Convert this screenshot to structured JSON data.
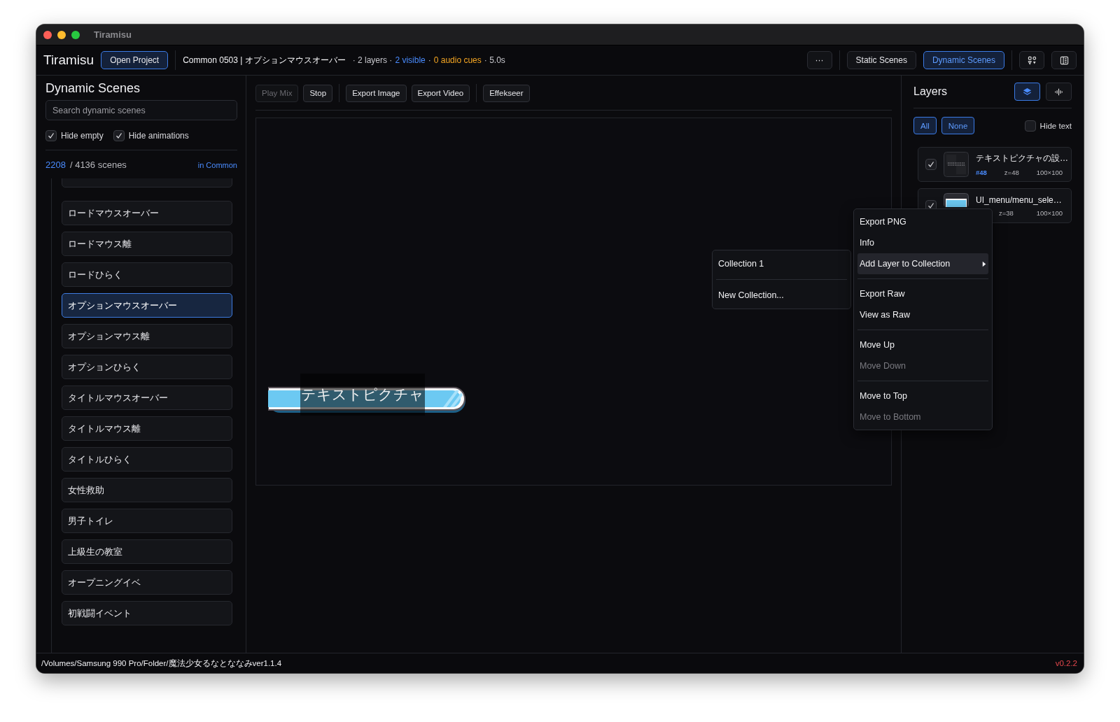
{
  "window": {
    "title": "Tiramisu"
  },
  "toolbar": {
    "app_name": "Tiramisu",
    "open_button": "Open Project",
    "scene_title": "Common 0503 | オプションマウスオーバー",
    "stats": [
      {
        "text": "· 2 layers ·",
        "kind": "plain"
      },
      {
        "text": "2 visible",
        "kind": "visible"
      },
      {
        "text": "·",
        "kind": "plain"
      },
      {
        "text": "0 audio cues",
        "kind": "audio"
      },
      {
        "text": "· 5.0s",
        "kind": "plain"
      }
    ],
    "more_button": "···",
    "mode_tabs": [
      {
        "label": "Static Scenes",
        "selected": false
      },
      {
        "label": "Dynamic Scenes",
        "selected": true
      }
    ]
  },
  "sidebar": {
    "title": "Dynamic Scenes",
    "search": {
      "placeholder": "Search dynamic scenes"
    },
    "filters": [
      {
        "label": "Hide empty",
        "checked": true
      },
      {
        "label": "Hide animations",
        "checked": true
      }
    ],
    "count": "2208",
    "total": "/ 4136 scenes",
    "scope": "in Common",
    "items": [
      {
        "label": "ロードマウスオーバー",
        "selected": false
      },
      {
        "label": "ロードマウス離",
        "selected": false
      },
      {
        "label": "ロードひらく",
        "selected": false
      },
      {
        "label": "オプションマウスオーバー",
        "selected": true
      },
      {
        "label": "オプションマウス離",
        "selected": false
      },
      {
        "label": "オプションひらく",
        "selected": false
      },
      {
        "label": "タイトルマウスオーバー",
        "selected": false
      },
      {
        "label": "タイトルマウス離",
        "selected": false
      },
      {
        "label": "タイトルひらく",
        "selected": false
      },
      {
        "label": "女性救助",
        "selected": false
      },
      {
        "label": "男子トイレ",
        "selected": false
      },
      {
        "label": "上級生の教室",
        "selected": false
      },
      {
        "label": "オープニングイベ",
        "selected": false
      },
      {
        "label": "初戦闘イベント",
        "selected": false
      }
    ]
  },
  "action_groups": [
    [
      {
        "label": "Play Mix",
        "disabled": true
      },
      {
        "label": "Stop",
        "disabled": false
      }
    ],
    [
      {
        "label": "Export Image",
        "disabled": false
      },
      {
        "label": "Export Video",
        "disabled": false
      }
    ],
    [
      {
        "label": "Effekseer",
        "disabled": false
      }
    ]
  ],
  "canvas": {
    "text_layer": "テキストピクチャ"
  },
  "layers_panel": {
    "title": "Layers",
    "view_toggles": [
      {
        "kind": "layers",
        "selected": true
      },
      {
        "kind": "audio",
        "selected": false
      }
    ],
    "filter_buttons": [
      "All",
      "None"
    ],
    "hide_text": {
      "label": "Hide text",
      "checked": false
    },
    "layers": [
      {
        "kind": "text",
        "name": "テキストピクチャの設…",
        "id": "#48",
        "z": "z=48",
        "size": "100×100",
        "checked": true
      },
      {
        "kind": "image",
        "name": "UI_menu/menu_sele…",
        "z": "z=38",
        "size": "100×100",
        "checked": true
      }
    ]
  },
  "context_menu": {
    "items": [
      {
        "kind": "item",
        "label": "Export PNG",
        "disabled": false,
        "highlighted": false,
        "submenu": false
      },
      {
        "kind": "item",
        "label": "Info",
        "disabled": false,
        "highlighted": false,
        "submenu": false
      },
      {
        "kind": "item",
        "label": "Add Layer to Collection",
        "disabled": false,
        "highlighted": true,
        "submenu": true
      },
      {
        "kind": "separator"
      },
      {
        "kind": "item",
        "label": "Export Raw",
        "disabled": false,
        "highlighted": false,
        "submenu": false
      },
      {
        "kind": "item",
        "label": "View as Raw",
        "disabled": false,
        "highlighted": false,
        "submenu": false
      },
      {
        "kind": "separator"
      },
      {
        "kind": "item",
        "label": "Move Up",
        "disabled": false,
        "highlighted": false,
        "submenu": false
      },
      {
        "kind": "item",
        "label": "Move Down",
        "disabled": true,
        "highlighted": false,
        "submenu": false
      },
      {
        "kind": "separator"
      },
      {
        "kind": "item",
        "label": "Move to Top",
        "disabled": false,
        "highlighted": false,
        "submenu": false
      },
      {
        "kind": "item",
        "label": "Move to Bottom",
        "disabled": true,
        "highlighted": false,
        "submenu": false
      }
    ],
    "submenu": [
      {
        "kind": "item",
        "label": "Collection 1"
      },
      {
        "kind": "separator"
      },
      {
        "kind": "item",
        "label": "New Collection..."
      }
    ]
  },
  "status_bar": {
    "path": "/Volumes/Samsung 990 Pro/Folder/魔法少女るなとななみver1.1.4",
    "version": "v0.2.2"
  }
}
